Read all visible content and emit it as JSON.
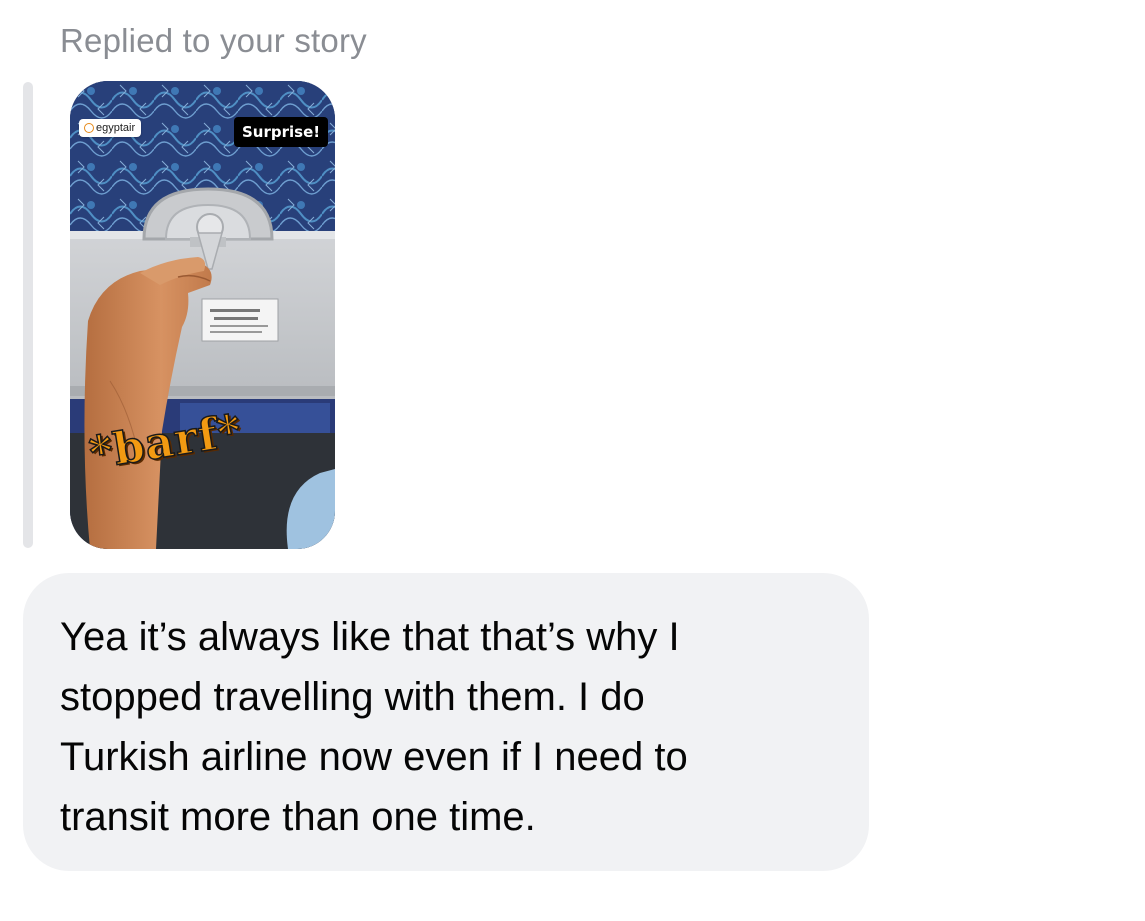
{
  "reply_label": "Replied to your story",
  "story": {
    "handle": "egyptair",
    "sticker_surprise": "Surprise!",
    "sticker_barf": "*barf*",
    "accent_color": "#f29a12"
  },
  "message": {
    "lines": [
      "Yea it’s always like that that’s why I",
      "stopped travelling with them. I do",
      "Turkish airline now even if I need to",
      "transit more than one time."
    ]
  }
}
